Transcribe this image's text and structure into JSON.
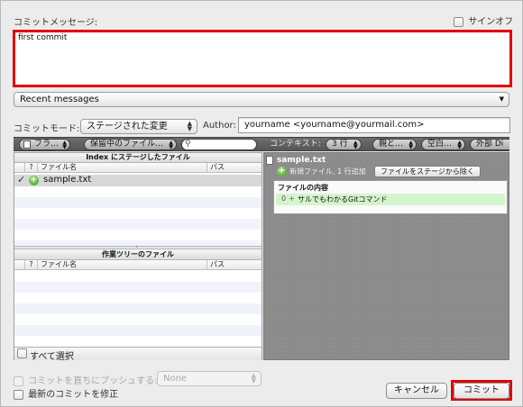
{
  "labels": {
    "commit_message": "コミットメッセージ:",
    "sign_off": "サインオフ",
    "commit_mode": "コミットモード:",
    "author": "Author:"
  },
  "message": {
    "value": "first commit"
  },
  "recent_messages": "Recent messages",
  "commit_mode_value": "ステージされた変更",
  "author_value": "yourname <yourname@yourmail.com>",
  "toolbar": {
    "file_filter": "フラ…",
    "pending_files": "保留中のファイル…",
    "context_label": "コンテキスト:",
    "context_value": "3 行",
    "parent_value": "親と…",
    "whitespace_value": "空白…",
    "external_diff": "外部 Di"
  },
  "staged_pane": {
    "title": "Index にステージしたファイル",
    "col_status": "?",
    "col_filename": "ファイル名",
    "col_path": "パス",
    "files": [
      {
        "name": "sample.txt"
      }
    ]
  },
  "worktree_pane": {
    "title": "作業ツリーのファイル",
    "col_status": "?",
    "col_filename": "ファイル名",
    "col_path": "パス"
  },
  "select_all": "すべて選択",
  "diff": {
    "filename": "sample.txt",
    "summary": "新規ファイル, 1 行追加",
    "unstage_button": "ファイルをステージから除く",
    "content_header": "ファイルの内容",
    "line_number": "0",
    "line_marker": "+",
    "line_text": "サルでもわかるGitコマンド"
  },
  "push_option": {
    "label": "コミットを直ちにプッシュする:",
    "target": "None"
  },
  "amend_label": "最新のコミットを修正",
  "buttons": {
    "cancel": "キャンセル",
    "commit": "コミット"
  },
  "colors": {
    "highlight_red": "#e00000",
    "added_line_green": "#d4f5cc"
  }
}
